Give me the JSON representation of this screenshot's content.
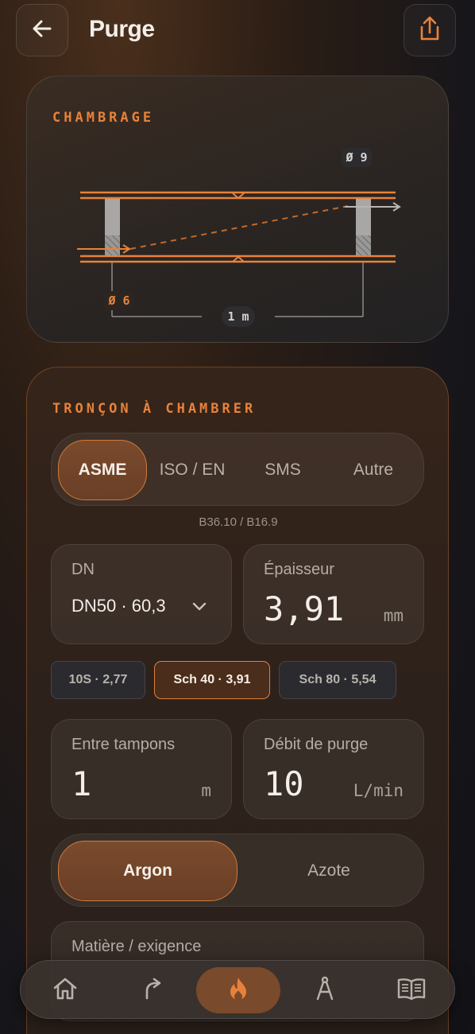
{
  "header": {
    "title": "Purge",
    "back_icon": "arrow-left-icon",
    "share_icon": "share-icon",
    "accent_color": "#e8823a"
  },
  "diagram": {
    "section_title": "CHAMBRAGE",
    "outlet_diameter": "Ø 9",
    "inlet_diameter": "Ø 6",
    "length_label": "1 m"
  },
  "form": {
    "section_title": "TRONÇON À CHAMBRER",
    "standards": [
      "ASME",
      "ISO / EN",
      "SMS",
      "Autre"
    ],
    "selected_standard": "ASME",
    "standard_note": "B36.10 / B16.9",
    "dn": {
      "label": "DN",
      "value": "DN50 · 60,3"
    },
    "thickness": {
      "label": "Épaisseur",
      "value": "3,91",
      "unit": "mm"
    },
    "schedules": [
      "10S · 2,77",
      "Sch 40 · 3,91",
      "Sch 80 · 5,54"
    ],
    "selected_schedule": "Sch 40 · 3,91",
    "between_plugs": {
      "label": "Entre tampons",
      "value": "1",
      "unit": "m"
    },
    "purge_rate": {
      "label": "Débit de purge",
      "value": "10",
      "unit": "L/min"
    },
    "gases": [
      "Argon",
      "Azote"
    ],
    "selected_gas": "Argon",
    "material": {
      "label": "Matière / exigence"
    }
  },
  "bottom_nav": {
    "items": [
      "home-icon",
      "bend-arrow-icon",
      "flame-icon",
      "compass-icon",
      "book-icon"
    ],
    "active": "flame-icon"
  }
}
